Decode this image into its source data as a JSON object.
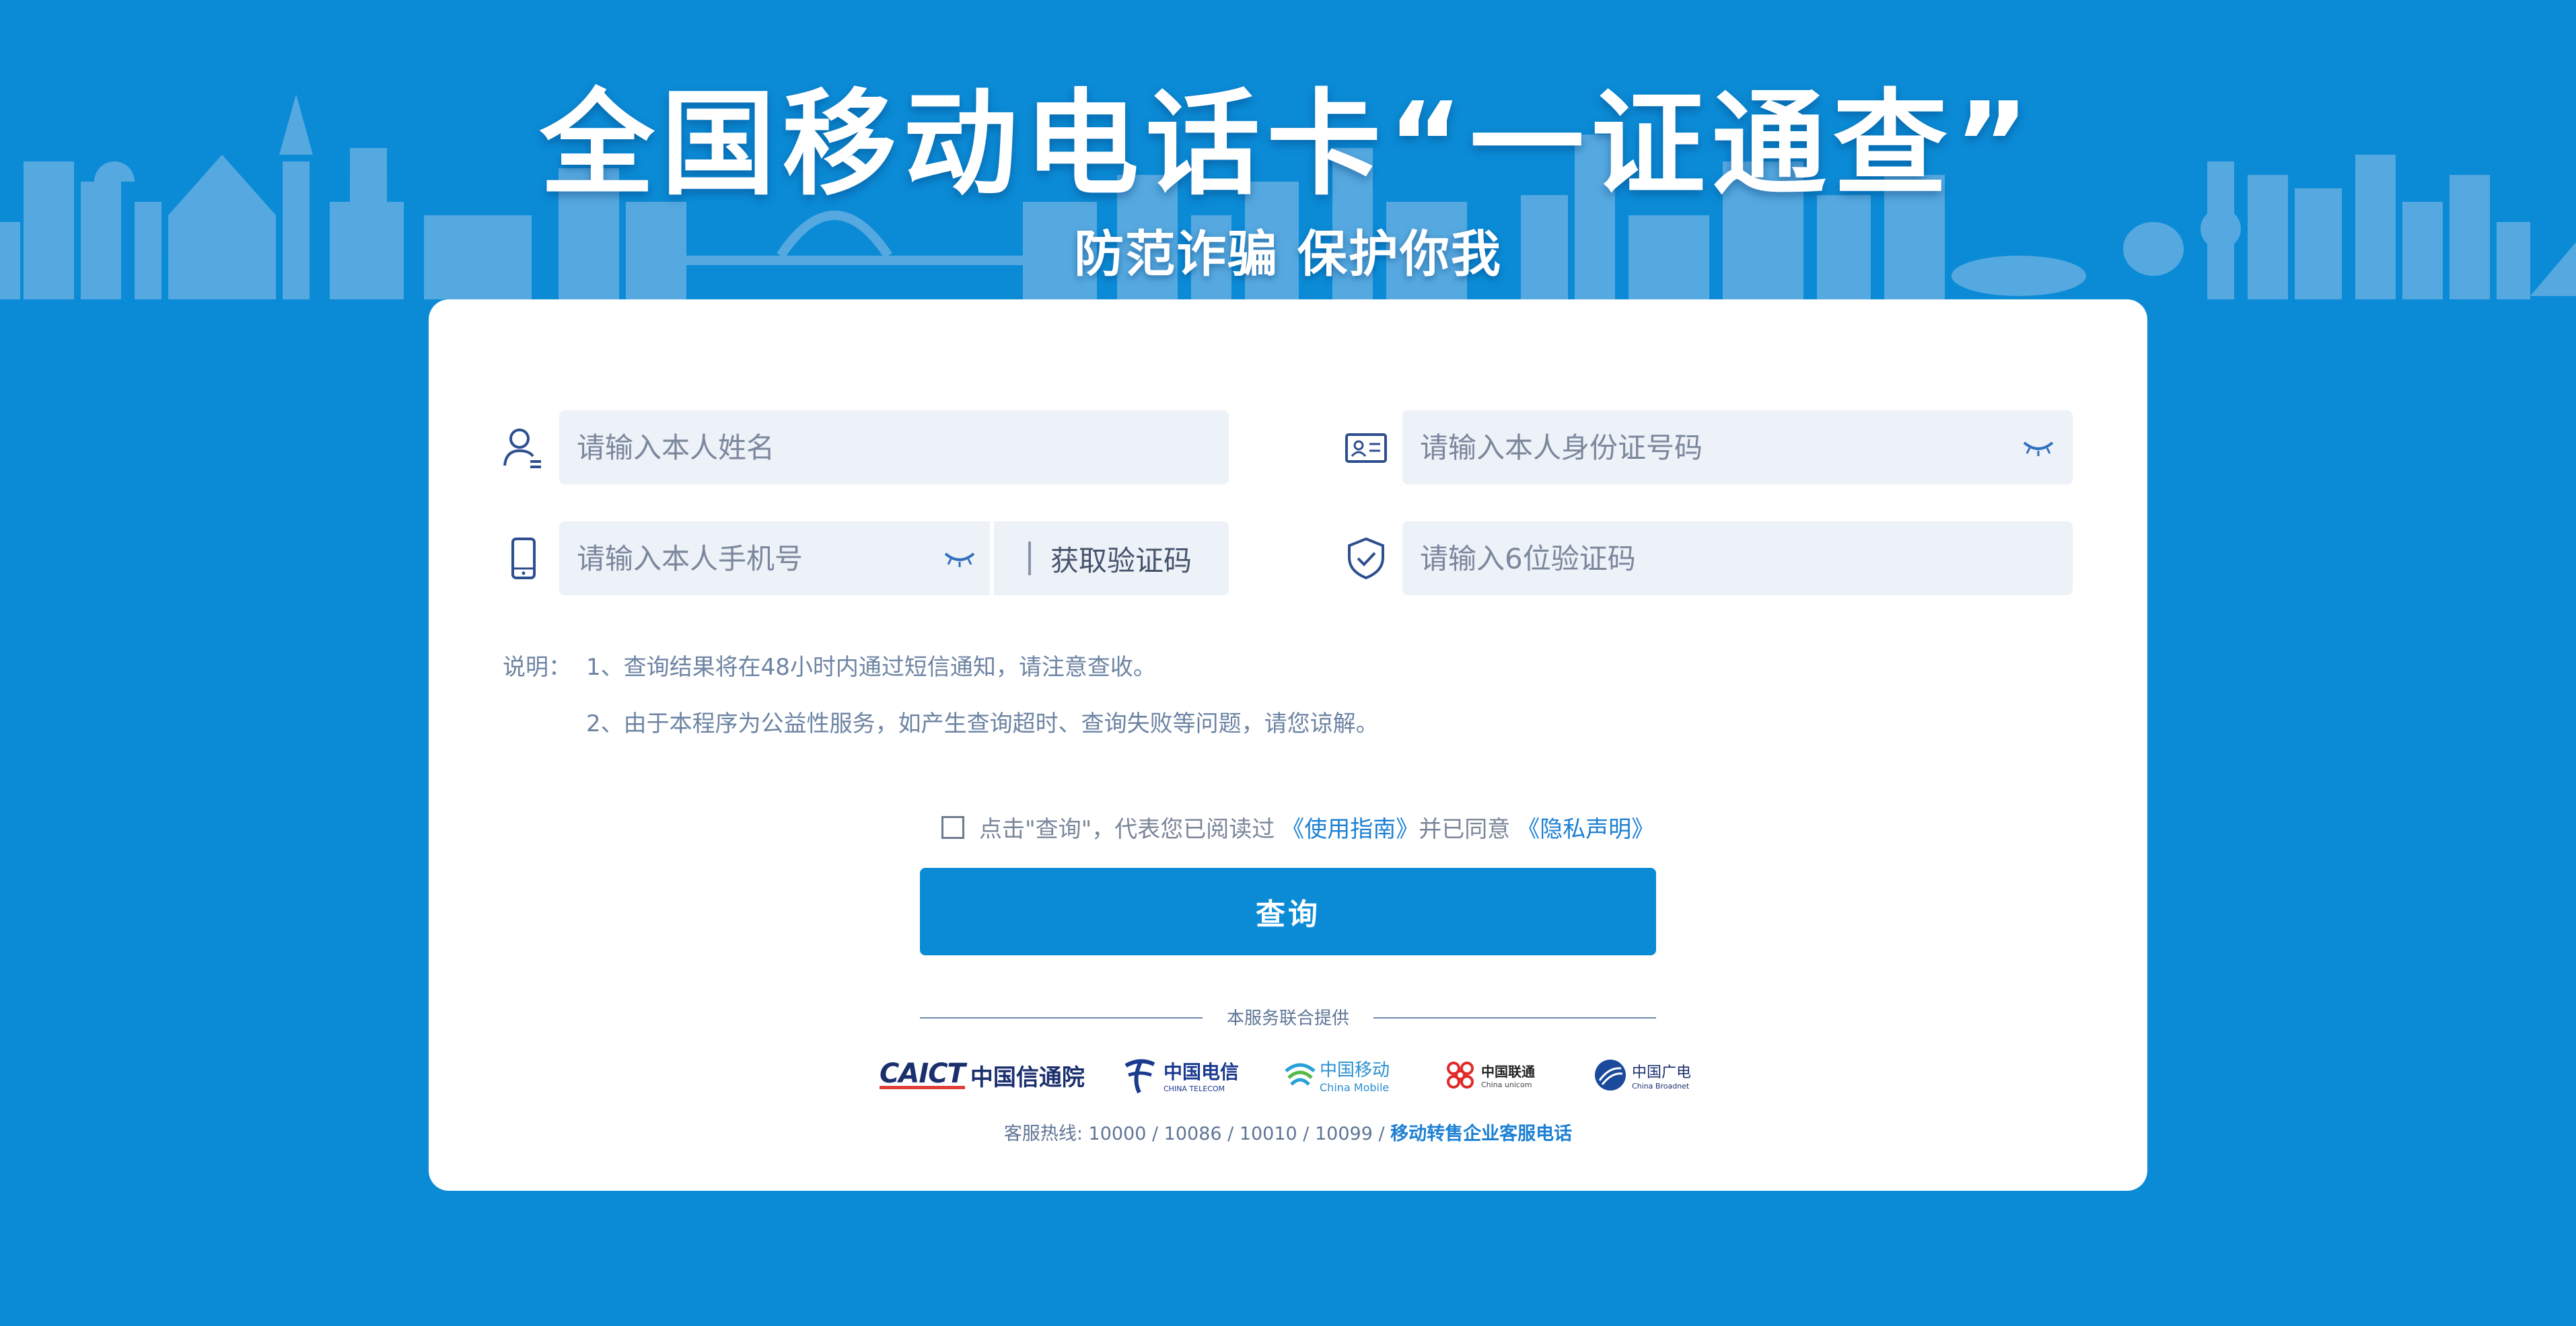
{
  "banner": {
    "title": "全国移动电话卡“一证通查”",
    "subtitle": "防范诈骗 保护你我"
  },
  "form": {
    "name_placeholder": "请输入本人姓名",
    "id_placeholder": "请输入本人身份证号码",
    "phone_placeholder": "请输入本人手机号",
    "sms_button": "获取验证码",
    "code_placeholder": "请输入6位验证码"
  },
  "notes": {
    "label": "说明：",
    "line1": "1、查询结果将在48小时内通过短信通知，请注意查收。",
    "line2": "2、由于本程序为公益性服务，如产生查询超时、查询失败等问题，请您谅解。"
  },
  "agreement": {
    "text_before": "点击\"查询\"，代表您已阅读过",
    "guide_link": "《使用指南》",
    "text_middle": "并已同意",
    "privacy_link": "《隐私声明》"
  },
  "query_button": "查询",
  "provider": {
    "text": "本服务联合提供",
    "caict_en": "CAICT",
    "caict_cn": "中国信通院",
    "telecom_cn": "中国电信",
    "telecom_en": "CHINA TELECOM",
    "mobile_cn": "中国移动",
    "mobile_en": "China Mobile",
    "unicom_cn": "中国联通",
    "unicom_en": "China unicom",
    "broadnet_cn": "中国广电",
    "broadnet_en": "China Broadnet"
  },
  "hotline": {
    "text": "客服热线: 10000 / 10086 / 10010 / 10099 / ",
    "link": "移动转售企业客服电话"
  },
  "colors": {
    "background": "#0b8bd6",
    "field": "#edf1f8",
    "icon": "#2e4f8f",
    "link": "#1c80d3"
  }
}
